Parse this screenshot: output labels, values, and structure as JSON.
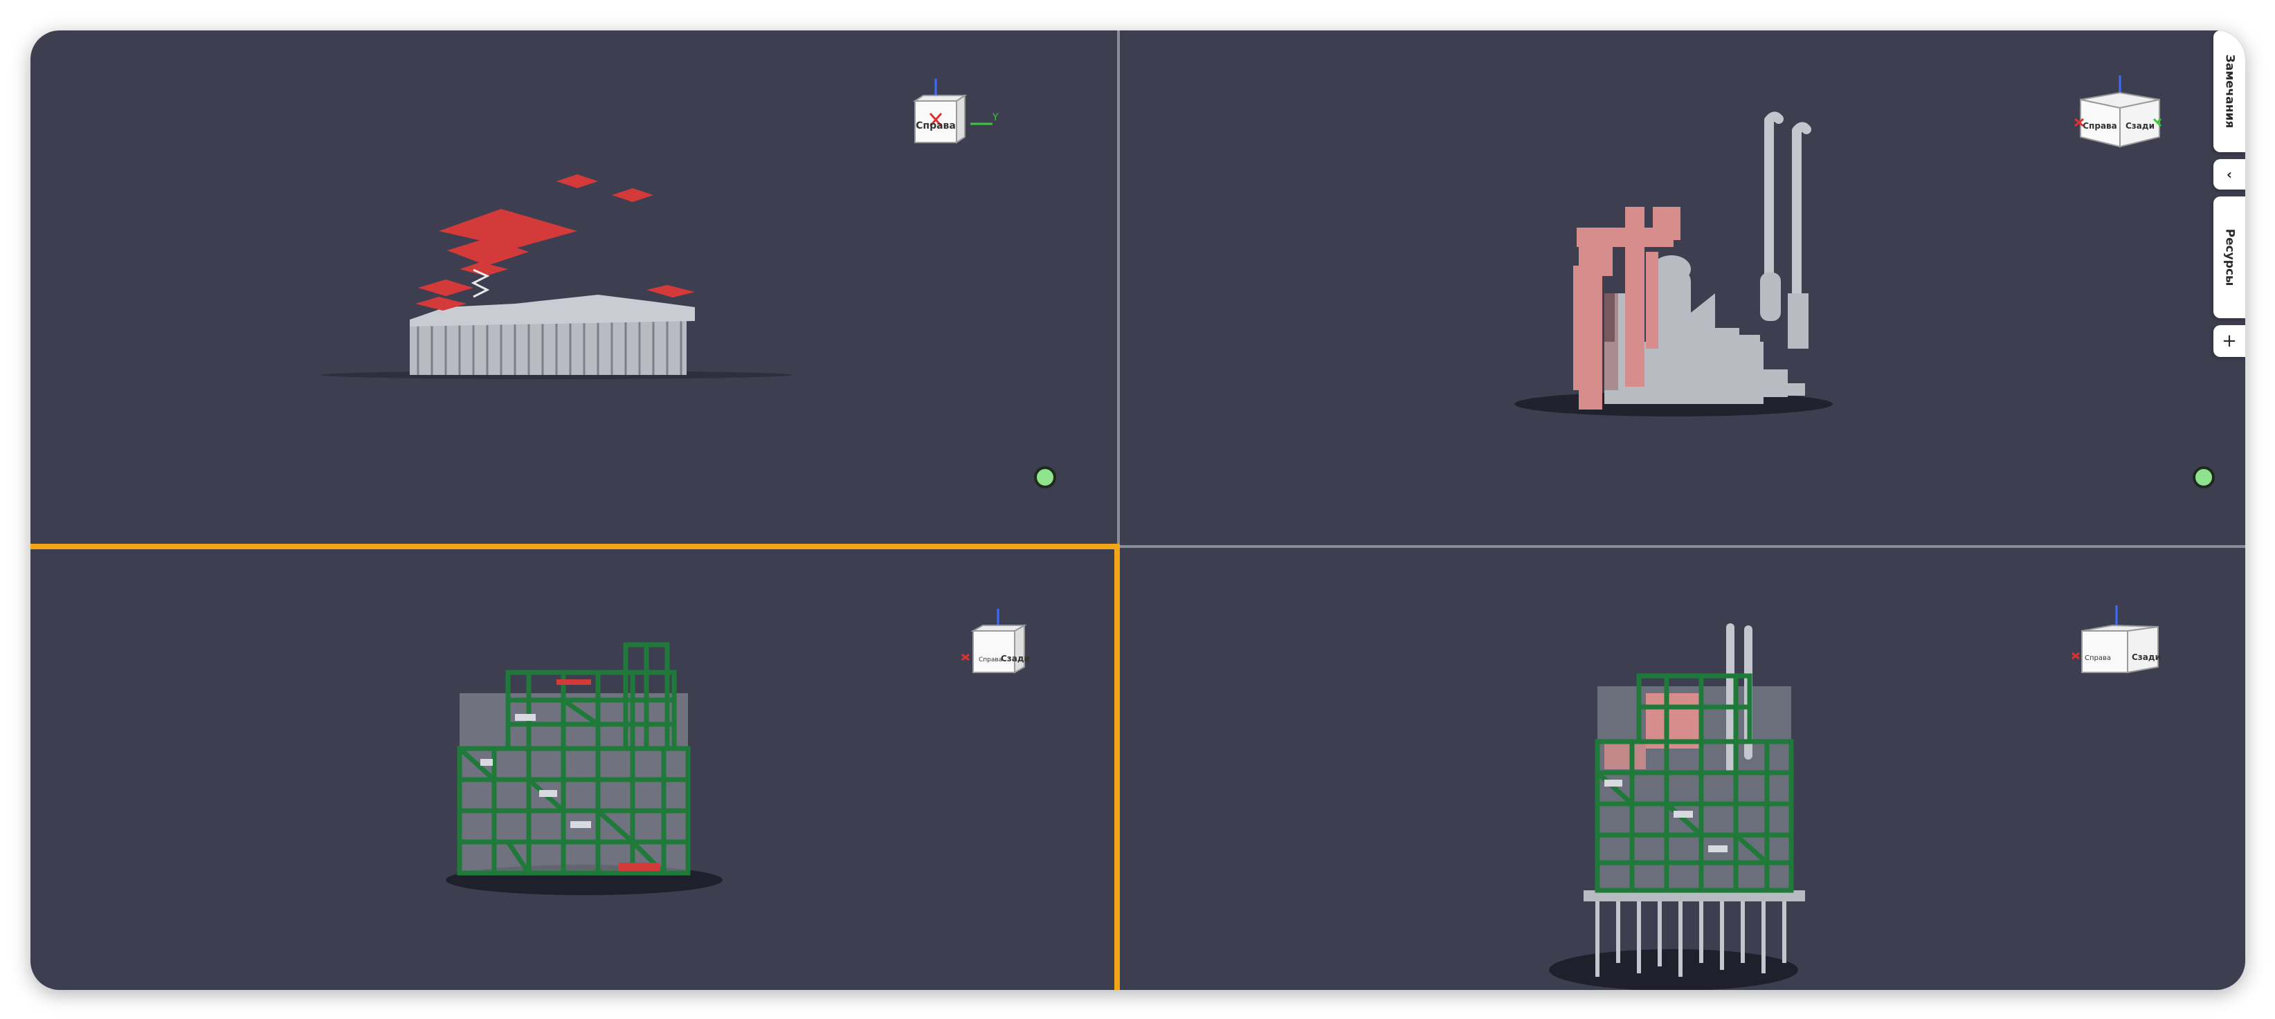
{
  "viewports": [
    {
      "id": "top-left",
      "cube_face_front": "Справа",
      "cube_face_side": "",
      "axes": [
        "Z",
        "X",
        "Y"
      ],
      "status": "connected"
    },
    {
      "id": "top-right",
      "cube_face_front": "Справа",
      "cube_face_side": "Сзади",
      "axes": [
        "Z",
        "X",
        "Y"
      ],
      "status": "connected"
    },
    {
      "id": "bottom-left",
      "cube_face_front": "Справа",
      "cube_face_side": "Сзади",
      "axes": [
        "Z",
        "X",
        "Y"
      ],
      "active": true
    },
    {
      "id": "bottom-right",
      "cube_face_front": "Справа",
      "cube_face_side": "Сзади",
      "axes": [
        "Z",
        "X",
        "Y"
      ]
    }
  ],
  "side_panel": {
    "notes_label": "Замечания",
    "collapse_label": "‹",
    "resources_label": "Ресурсы",
    "add_label": "+"
  },
  "colors": {
    "background": "#3d3f50",
    "active_border": "#f2a516",
    "status_ok": "#8fe38f",
    "model_red": "#d43a3a",
    "model_pink": "#d88d8d",
    "model_grey": "#b8bcc2",
    "model_green": "#1f7a3a"
  },
  "icons": [
    "navigation-cube-icon",
    "axis-gizmo-icon",
    "status-dot-icon",
    "chevron-left-icon",
    "plus-icon"
  ]
}
